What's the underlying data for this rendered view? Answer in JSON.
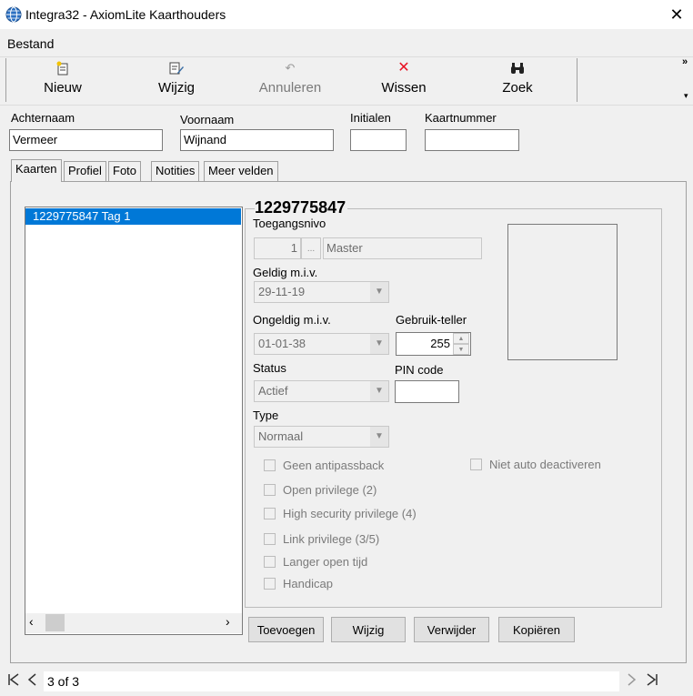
{
  "window": {
    "title": "Integra32 - AxiomLite Kaarthouders",
    "close_glyph": "✕"
  },
  "menu": {
    "bestand": "Bestand"
  },
  "toolbar": {
    "items": [
      {
        "label": "Nieuw",
        "icon": "✱"
      },
      {
        "label": "Wijzig",
        "icon": "✎"
      },
      {
        "label": "Annuleren",
        "icon": "↶"
      },
      {
        "label": "Wissen",
        "icon": "✕"
      },
      {
        "label": "Zoek",
        "icon": "⚲"
      }
    ],
    "overflow": "»",
    "dropdown": "▾"
  },
  "header": {
    "achternaam_label": "Achternaam",
    "achternaam_value": "Vermeer",
    "voornaam_label": "Voornaam",
    "voornaam_value": "Wijnand",
    "initialen_label": "Initialen",
    "initialen_value": "",
    "kaartnummer_label": "Kaartnummer",
    "kaartnummer_value": ""
  },
  "tabs": [
    "Kaarten",
    "Profiel",
    "Foto",
    "Notities",
    "Meer velden"
  ],
  "cards": {
    "list_item": "1229775847  Tag 1",
    "heading": "1229775847",
    "toegangsnivo_label": "Toegangsnivo",
    "toegangsnivo_num": "1",
    "toegangsnivo_btn": "...",
    "toegangsnivo_name": "Master",
    "geldig_label": "Geldig m.i.v.",
    "geldig_value": "29-11-19",
    "ongeldig_label": "Ongeldig m.i.v.",
    "ongeldig_value": "01-01-38",
    "teller_label": "Gebruik-teller",
    "teller_value": "255",
    "status_label": "Status",
    "status_value": "Actief",
    "pin_label": "PIN code",
    "pin_value": "",
    "type_label": "Type",
    "type_value": "Normaal",
    "checks": [
      "Geen antipassback",
      "Open privilege (2)",
      "High security privilege (4)",
      "Link privilege (3/5)",
      "Langer open tijd",
      "Handicap"
    ],
    "niet_auto": "Niet auto deactiveren",
    "buttons": {
      "toevoegen": "Toevoegen",
      "wijzig": "Wijzig",
      "verwijder": "Verwijder",
      "kopieren": "Kopiëren"
    }
  },
  "nav": {
    "record": "3 of 3"
  },
  "colors": {
    "selection": "#0078d7",
    "wissen_icon": "#e81123"
  }
}
